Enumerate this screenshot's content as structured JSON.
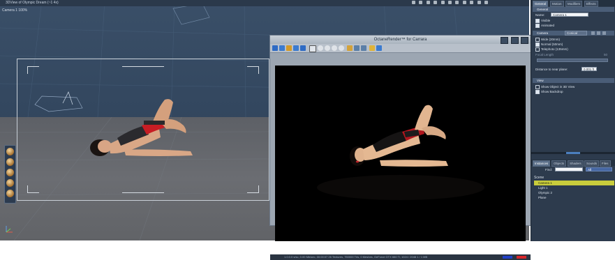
{
  "viewport": {
    "title": "3DView of Olympic Dream (~1 4x)",
    "camera_label": "Camera 1 100%"
  },
  "octane": {
    "title": "OctaneRender™ for Carrara",
    "status": "1.0.0.0 s/sc, 0.00 Mb/sec, 00:00:07          26 Textures, 750000 Tris, 0 Meshes, GeForce GTX 660 Ti, 1024 / 2048 1 / 1 MB"
  },
  "panel": {
    "tabs": [
      "General",
      "Motion",
      "Modifiers",
      "Effects"
    ],
    "general_section": "General",
    "name_label": "Name:",
    "name_value": "Camera 1",
    "visible_label": "Visible",
    "animated_label": "Animated",
    "camera_section": "Camera",
    "camera_type": "Conical",
    "wide_label": "Wide (20mm)",
    "normal_label": "Normal (50mm)",
    "telephoto_label": "Telephoto (135mm)",
    "focal_length_label": "Focal Length",
    "focal_length_value": "50",
    "distance_label": "Distance to near plane:",
    "distance_value": "0.001 ft",
    "view_section": "View",
    "show_object_label": "Show Object in 3D View",
    "show_backdrop_label": "Show Backdrop",
    "instances_tabs": [
      "Instances",
      "Objects",
      "Shaders",
      "Sounds",
      "Files"
    ],
    "find_label": "Find:",
    "find_filter": "All",
    "scene_label": "Scene",
    "scene_items": [
      "Camera 1",
      "Light 1",
      "Olympic 2",
      "Plane"
    ]
  }
}
